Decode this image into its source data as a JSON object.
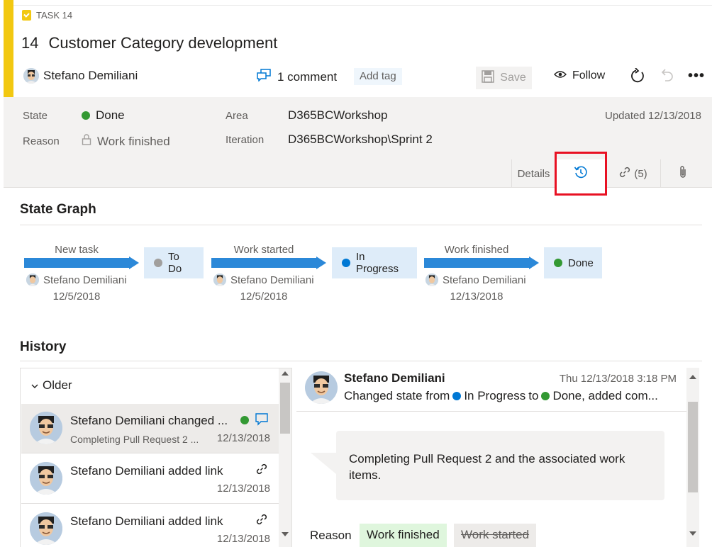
{
  "header": {
    "work_item_type": "TASK 14",
    "id": "14",
    "title": "Customer Category development",
    "assignee": "Stefano Demiliani",
    "comments": "1 comment",
    "add_tag": "Add tag",
    "save": "Save",
    "follow": "Follow",
    "more": "•••"
  },
  "fields": {
    "state_label": "State",
    "state_value": "Done",
    "reason_label": "Reason",
    "reason_value": "Work finished",
    "area_label": "Area",
    "area_value": "D365BCWorkshop",
    "iteration_label": "Iteration",
    "iteration_value": "D365BCWorkshop\\Sprint 2",
    "updated": "Updated 12/13/2018"
  },
  "tabs": {
    "details": "Details",
    "links_count": "(5)"
  },
  "state_graph": {
    "title": "State Graph",
    "transitions": [
      {
        "label": "New task",
        "by": "Stefano Demiliani",
        "date": "12/5/2018",
        "to": "To Do",
        "color": "#a19f9d"
      },
      {
        "label": "Work started",
        "by": "Stefano Demiliani",
        "date": "12/5/2018",
        "to": "In Progress",
        "color": "#0078d4"
      },
      {
        "label": "Work finished",
        "by": "Stefano Demiliani",
        "date": "12/13/2018",
        "to": "Done",
        "color": "#339933"
      }
    ]
  },
  "history": {
    "title": "History",
    "group": "Older",
    "items": [
      {
        "title": "Stefano Demiliani changed ...",
        "sub": "Completing Pull Request 2 ...",
        "date": "12/13/2018"
      },
      {
        "title": "Stefano Demiliani added link",
        "sub": "",
        "date": "12/13/2018"
      },
      {
        "title": "Stefano Demiliani added link",
        "sub": "",
        "date": "12/13/2018"
      }
    ],
    "detail": {
      "author": "Stefano Demiliani",
      "time": "Thu 12/13/2018 3:18 PM",
      "summary_prefix": "Changed state from",
      "from_state": "In Progress",
      "to_word": "to",
      "to_state": "Done, added com...",
      "comment": "Completing Pull Request 2 and the associated work items.",
      "reason_label": "Reason",
      "reason_new": "Work finished",
      "reason_old": "Work started"
    }
  },
  "colors": {
    "accent": "#0078d4",
    "done": "#339933",
    "todo": "#a19f9d",
    "task_yellow": "#f2c811",
    "highlight": "#e81123"
  }
}
